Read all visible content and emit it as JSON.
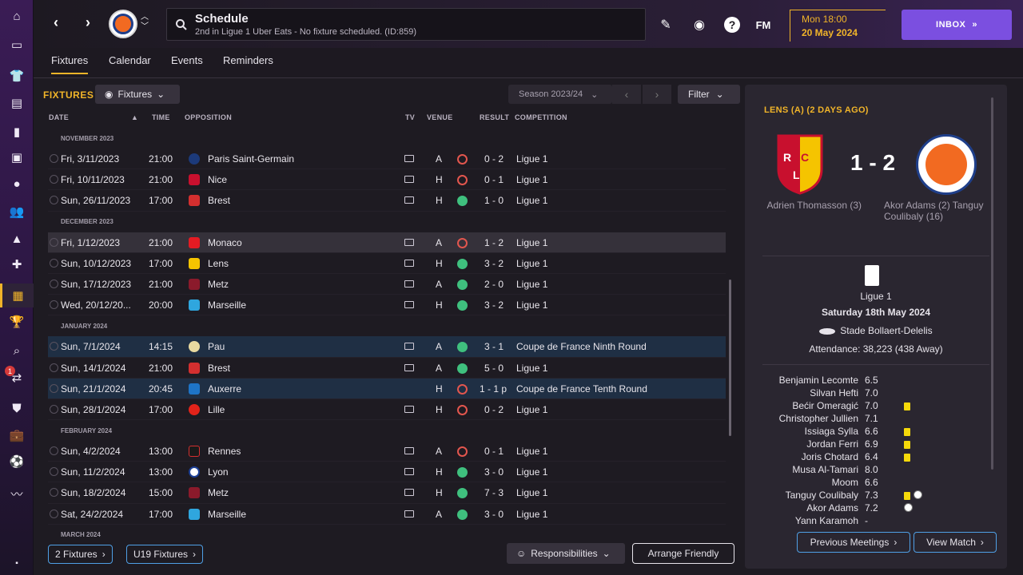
{
  "header": {
    "title": "Schedule",
    "subtitle": "2nd in Ligue 1 Uber Eats - No fixture scheduled. (ID:859)",
    "date_line1": "Mon 18:00",
    "date_line2": "20 May 2024",
    "inbox_label": "INBOX",
    "fm_label": "FM",
    "help_label": "?"
  },
  "tabs": [
    "Fixtures",
    "Calendar",
    "Events",
    "Reminders"
  ],
  "fixtures": {
    "section_title": "FIXTURES",
    "dropdown_label": "Fixtures",
    "season_label": "Season 2023/24",
    "filter_label": "Filter",
    "columns": {
      "date": "DATE",
      "time": "TIME",
      "opposition": "OPPOSITION",
      "tv": "TV",
      "venue": "VENUE",
      "result": "RESULT",
      "competition": "COMPETITION"
    },
    "months": [
      "NOVEMBER 2023",
      "DECEMBER 2023",
      "JANUARY 2024",
      "FEBRUARY 2024",
      "MARCH 2024"
    ],
    "rows": [
      {
        "date": "Fri, 3/11/2023",
        "time": "21:00",
        "opp": "Paris Saint-Germain",
        "venue": "A",
        "result": "0 - 2",
        "comp": "Ligue 1"
      },
      {
        "date": "Fri, 10/11/2023",
        "time": "21:00",
        "opp": "Nice",
        "venue": "H",
        "result": "0 - 1",
        "comp": "Ligue 1"
      },
      {
        "date": "Sun, 26/11/2023",
        "time": "17:00",
        "opp": "Brest",
        "venue": "H",
        "result": "1 - 0",
        "comp": "Ligue 1"
      },
      {
        "date": "Fri, 1/12/2023",
        "time": "21:00",
        "opp": "Monaco",
        "venue": "A",
        "result": "1 - 2",
        "comp": "Ligue 1"
      },
      {
        "date": "Sun, 10/12/2023",
        "time": "17:00",
        "opp": "Lens",
        "venue": "H",
        "result": "3 - 2",
        "comp": "Ligue 1"
      },
      {
        "date": "Sun, 17/12/2023",
        "time": "21:00",
        "opp": "Metz",
        "venue": "A",
        "result": "2 - 0",
        "comp": "Ligue 1"
      },
      {
        "date": "Wed, 20/12/20...",
        "time": "20:00",
        "opp": "Marseille",
        "venue": "H",
        "result": "3 - 2",
        "comp": "Ligue 1"
      },
      {
        "date": "Sun, 7/1/2024",
        "time": "14:15",
        "opp": "Pau",
        "venue": "A",
        "result": "3 - 1",
        "comp": "Coupe de France Ninth Round"
      },
      {
        "date": "Sun, 14/1/2024",
        "time": "21:00",
        "opp": "Brest",
        "venue": "A",
        "result": "5 - 0",
        "comp": "Ligue 1"
      },
      {
        "date": "Sun, 21/1/2024",
        "time": "20:45",
        "opp": "Auxerre",
        "venue": "H",
        "result": "1 - 1 p",
        "comp": "Coupe de France Tenth Round"
      },
      {
        "date": "Sun, 28/1/2024",
        "time": "17:00",
        "opp": "Lille",
        "venue": "H",
        "result": "0 - 2",
        "comp": "Ligue 1"
      },
      {
        "date": "Sun, 4/2/2024",
        "time": "13:00",
        "opp": "Rennes",
        "venue": "A",
        "result": "0 - 1",
        "comp": "Ligue 1"
      },
      {
        "date": "Sun, 11/2/2024",
        "time": "13:00",
        "opp": "Lyon",
        "venue": "H",
        "result": "3 - 0",
        "comp": "Ligue 1"
      },
      {
        "date": "Sun, 18/2/2024",
        "time": "15:00",
        "opp": "Metz",
        "venue": "H",
        "result": "7 - 3",
        "comp": "Ligue 1"
      },
      {
        "date": "Sat, 24/2/2024",
        "time": "17:00",
        "opp": "Marseille",
        "venue": "A",
        "result": "3 - 0",
        "comp": "Ligue 1"
      }
    ],
    "btn_fixtures2": "2 Fixtures",
    "btn_u19": "U19 Fixtures",
    "btn_responsibilities": "Responsibilities",
    "btn_arrange": "Arrange Friendly"
  },
  "match": {
    "title": "LENS (A) (2 DAYS AGO)",
    "score": "1 - 2",
    "home_scorers": "Adrien Thomasson (3)",
    "away_scorers": "Akor Adams (2) Tanguy Coulibaly (16)",
    "competition": "Ligue 1",
    "date": "Saturday 18th May 2024",
    "stadium": "Stade Bollaert-Delelis",
    "attendance": "Attendance: 38,223 (438 Away)",
    "players": [
      {
        "name": "Benjamin Lecomte",
        "rating": "6.5"
      },
      {
        "name": "Silvan Hefti",
        "rating": "7.0"
      },
      {
        "name": "Bećir Omeragić",
        "rating": "7.0"
      },
      {
        "name": "Christopher Jullien",
        "rating": "7.1"
      },
      {
        "name": "Issiaga Sylla",
        "rating": "6.6"
      },
      {
        "name": "Jordan Ferri",
        "rating": "6.9"
      },
      {
        "name": "Joris Chotard",
        "rating": "6.4"
      },
      {
        "name": "Musa Al-Tamari",
        "rating": "8.0"
      },
      {
        "name": "Moom",
        "rating": "6.6"
      },
      {
        "name": "Tanguy Coulibaly",
        "rating": "7.3"
      },
      {
        "name": "Akor Adams",
        "rating": "7.2"
      },
      {
        "name": "Yann Karamoh",
        "rating": "-"
      }
    ],
    "btn_previous": "Previous Meetings",
    "btn_view": "View Match"
  },
  "rail_badge": "1"
}
